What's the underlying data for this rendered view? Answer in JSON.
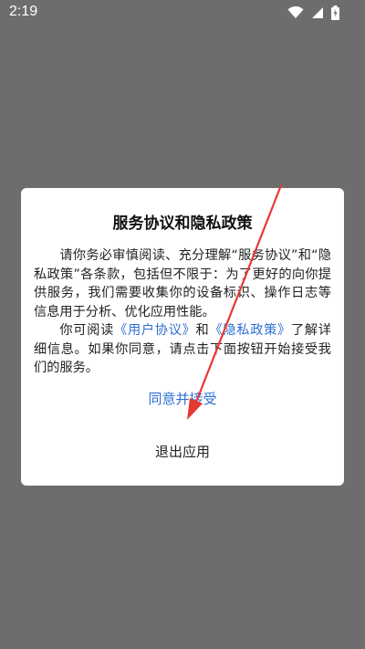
{
  "status_bar": {
    "time": "2:19",
    "icons": [
      "wifi-icon",
      "signal-icon",
      "battery-icon"
    ]
  },
  "dialog": {
    "title": "服务协议和隐私政策",
    "para1": "请你务必审慎阅读、充分理解“服务协议”和“隐私政策”各条款，包括但不限于：为了更好的向你提供服务，我们需要收集你的设备标识、操作日志等信息用于分析、优化应用性能。",
    "para2_prefix": "你可阅读",
    "user_agreement_link": "《用户协议》",
    "and_text": "和",
    "privacy_policy_link": "《隐私政策》",
    "para2_suffix": "了解详细信息。如果你同意，请点击下面按钮开始接受我们的服务。",
    "agree_label": "同意并接受",
    "exit_label": "退出应用"
  },
  "colors": {
    "link": "#2d6fd2",
    "annotation_arrow": "#e53935",
    "overlay": "#6d6d6d"
  }
}
